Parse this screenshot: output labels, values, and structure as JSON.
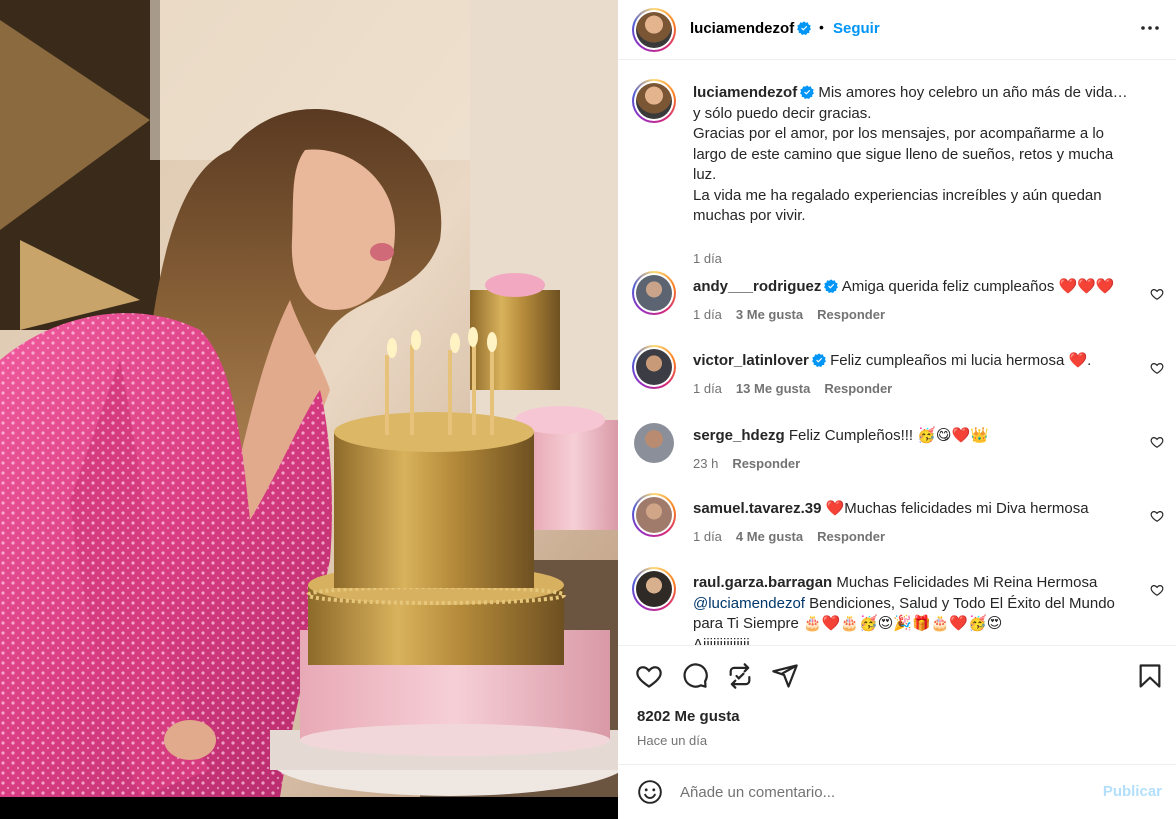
{
  "post": {
    "username": "luciamendezof",
    "follow_label": "Seguir",
    "separator": "•",
    "caption_lines": [
      "Mis amores hoy celebro un año más de vida…",
      "y sólo puedo decir gracias.",
      "Gracias por el amor, por los mensajes, por acompañarme a lo",
      "largo de este camino que sigue lleno de sueños, retos y mucha",
      "luz.",
      "La vida me ha regalado experiencias increíbles y aún quedan",
      "muchas por vivir."
    ],
    "caption_time": "1 día",
    "likes": "8202 Me gusta",
    "posted_ago": "Hace un día"
  },
  "comments": [
    {
      "user": "andy___rodriguez",
      "text": "Amiga querida feliz cumpleaños ❤️❤️❤️",
      "time": "1 día",
      "likes": "3 Me gusta",
      "reply": "Responder"
    },
    {
      "user": "victor_latinlover",
      "text": "Feliz cumpleaños mi lucia hermosa ❤️.",
      "time": "1 día",
      "likes": "13 Me gusta",
      "reply": "Responder"
    },
    {
      "user": "serge_hdezg",
      "text": "Feliz Cumpleños!!! 🥳😋❤️👑",
      "time": "23 h",
      "reply": "Responder"
    },
    {
      "user": "samuel.tavarez.39",
      "text": "❤️Muchas felicidades mi Diva hermosa",
      "time": "1 día",
      "likes": "4 Me gusta",
      "reply": "Responder"
    },
    {
      "user": "raul.garza.barragan",
      "text_a": "Muchas Felicidades Mi Reina Hermosa",
      "mention": "@luciamendezof",
      "text_b": "Bendiciones, Salud y Todo El Éxito del Mundo",
      "text_c": "para Ti Siempre 🎂❤️🎂🥳😍🎉🎁🎂❤️🥳😍",
      "text_d": "Aiiiiiiiiiiiiii"
    }
  ],
  "composer": {
    "placeholder": "Añade un comentario...",
    "publish_label": "Publicar"
  },
  "icons": {
    "verified": "verified-badge-icon",
    "more": "more-options-icon",
    "like": "heart-icon",
    "comment": "comment-icon",
    "share": "repost-icon",
    "send": "send-icon",
    "save": "bookmark-icon",
    "emoji": "emoji-icon"
  },
  "colors": {
    "accent": "#0095f6",
    "verified": "#0095f6",
    "heart_red": "#e0102e",
    "muted": "#737373",
    "dress": "#e1408a",
    "gold": "#c9a24b"
  }
}
